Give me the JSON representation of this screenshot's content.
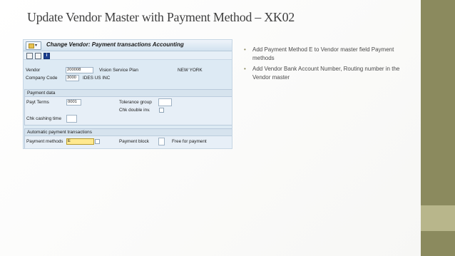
{
  "slide": {
    "title": "Update Vendor Master with Payment Method – XK02",
    "bullets": [
      "Add Payment Method E to Vendor master field Payment methods",
      "Add Vendor Bank Account Number, Routing number in the Vendor master"
    ],
    "colors": {
      "band_dark": "#8b8a5e",
      "band_light": "#b8b68b"
    }
  },
  "sap": {
    "window_title": "Change Vendor: Payment transactions Accounting",
    "toolbar_icons": [
      "save-icon",
      "document-icon",
      "info-icon"
    ],
    "header": {
      "vendor_label": "Vendor",
      "vendor_value": "200008",
      "vendor_name": "Vision Service Plan",
      "vendor_city": "NEW YORK",
      "company_code_label": "Company Code",
      "company_code_value": "3000",
      "company_name": "IDES US INC"
    },
    "payment_data": {
      "title": "Payment data",
      "payt_terms_label": "Payt Terms",
      "payt_terms_value": "0001",
      "tolerance_group_label": "Tolerance group",
      "tolerance_group_value": "",
      "chk_double_label": "Chk double inv.",
      "chk_cashing_label": "Chk cashing time",
      "chk_cashing_value": ""
    },
    "auto_payment": {
      "title": "Automatic payment transactions",
      "payment_methods_label": "Payment methods",
      "payment_methods_value": "E",
      "payment_block_label": "Payment block",
      "payment_block_value": "",
      "payment_block_text": "Free for payment"
    },
    "colors": {
      "panel_bg": "#ddeaf4",
      "focused_field": "#ffe98f"
    }
  }
}
